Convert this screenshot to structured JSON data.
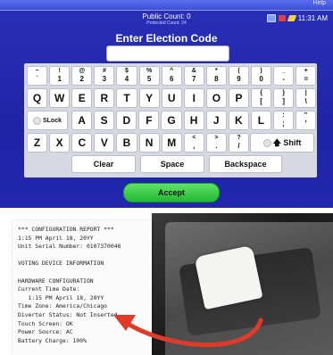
{
  "topbar": {
    "help_label": "Help"
  },
  "status": {
    "public_count": "Public Count: 0",
    "protected_count": "Protected Count: 24",
    "time": "11:31 AM"
  },
  "title": "Enter Election Code",
  "keyboard": {
    "row1": [
      {
        "top": "~",
        "bot": "`"
      },
      {
        "top": "!",
        "bot": "1"
      },
      {
        "top": "@",
        "bot": "2"
      },
      {
        "top": "#",
        "bot": "3"
      },
      {
        "top": "$",
        "bot": "4"
      },
      {
        "top": "%",
        "bot": "5"
      },
      {
        "top": "^",
        "bot": "6"
      },
      {
        "top": "&",
        "bot": "7"
      },
      {
        "top": "*",
        "bot": "8"
      },
      {
        "top": "(",
        "bot": "9"
      },
      {
        "top": ")",
        "bot": "0"
      },
      {
        "top": "_",
        "bot": "-"
      },
      {
        "top": "+",
        "bot": "="
      }
    ],
    "row2": [
      "Q",
      "W",
      "E",
      "R",
      "T",
      "Y",
      "U",
      "I",
      "O",
      "P",
      {
        "top": "{",
        "bot": "["
      },
      {
        "top": "}",
        "bot": "]"
      },
      {
        "top": "|",
        "bot": "\\"
      }
    ],
    "row3": [
      "A",
      "S",
      "D",
      "F",
      "G",
      "H",
      "J",
      "K",
      "L",
      {
        "top": ":",
        "bot": ";"
      },
      {
        "top": "\"",
        "bot": "'"
      }
    ],
    "row4": [
      "Z",
      "X",
      "C",
      "V",
      "B",
      "N",
      "M",
      {
        "top": "<",
        "bot": ","
      },
      {
        "top": ">",
        "bot": "."
      },
      {
        "top": "?",
        "bot": "/"
      }
    ],
    "slock_label": "SLock",
    "shift_label": "Shift",
    "clear_label": "Clear",
    "space_label": "Space",
    "backspace_label": "Backspace"
  },
  "accept_label": "Accept",
  "receipt": {
    "lines": [
      "*** CONFIGURATION REPORT ***",
      "1:15 PM April 18, 20YY",
      "Unit Serial Number: 0107370046",
      "",
      "VOTING DEVICE INFORMATION",
      "",
      "HARDWARE CONFIGURATION",
      "Current Time Date:",
      "   1:15 PM April 18, 20YY",
      "Time Zone: America/Chicago",
      "Diverter Status: Not Inserted",
      "Touch Screen: OK",
      "Power Source: AC",
      "Battery Charge: 100%"
    ]
  },
  "colors": {
    "screen_bg": "#2126ad",
    "accept": "#22b82e",
    "arrow": "#e03a2a"
  }
}
